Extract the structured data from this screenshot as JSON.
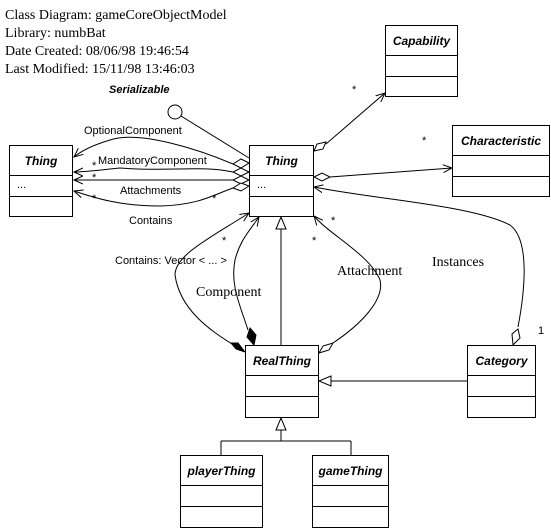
{
  "header": {
    "diagram": "Class Diagram: gameCoreObjectModel",
    "library": "Library: numbBat",
    "created": "Date Created: 08/06/98 19:46:54",
    "modified": "Last Modified: 15/11/98 13:46:03"
  },
  "interface": {
    "name": "Serializable"
  },
  "classes": {
    "thing_left": {
      "name": "Thing",
      "attrs": "..."
    },
    "thing_center": {
      "name": "Thing",
      "attrs": "..."
    },
    "capability": {
      "name": "Capability",
      "attrs": ""
    },
    "characteristic": {
      "name": "Characteristic",
      "attrs": ""
    },
    "realthing": {
      "name": "RealThing",
      "attrs": ""
    },
    "category": {
      "name": "Category",
      "attrs": ""
    },
    "playerthing": {
      "name": "playerThing",
      "attrs": ""
    },
    "gamething": {
      "name": "gameThing",
      "attrs": ""
    }
  },
  "associations": {
    "optional_component": "OptionalComponent",
    "mandatory_component": "MandatoryComponent",
    "attachments": "Attachments",
    "contains": "Contains",
    "contains_vector": "Contains: Vector < ... >",
    "component": "Component",
    "attachment": "Attachment",
    "instances": "Instances"
  },
  "multiplicities": {
    "many": "*",
    "one": "1"
  }
}
